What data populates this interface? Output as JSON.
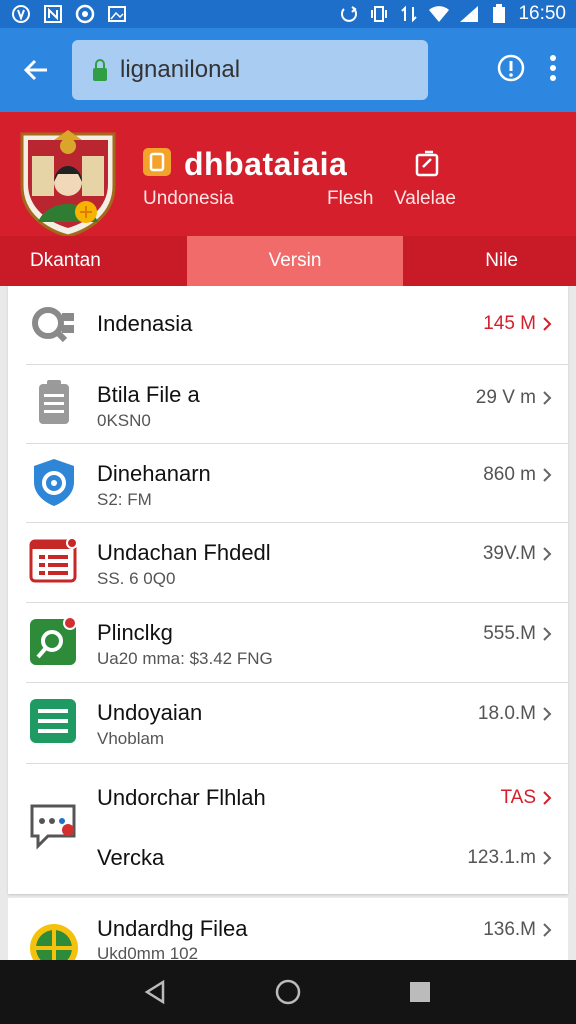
{
  "status_bar": {
    "time": "16:50",
    "icons_left": [
      "vpn-icon",
      "n-app-icon",
      "record-icon",
      "image-icon"
    ],
    "icons_right": [
      "sync-icon",
      "vibrate-icon",
      "data-arrows-icon",
      "wifi-icon",
      "signal-icon",
      "battery-icon"
    ]
  },
  "browser": {
    "url": "lignanilonal",
    "back_icon": "arrow-left-icon",
    "lock_icon": "lock-icon",
    "info_icon": "info-icon",
    "menu_icon": "more-vert-icon"
  },
  "header": {
    "app_title": "dhbataiaia",
    "app_subtitle": "Undonesia",
    "flesh_label": "Flesh",
    "valelae_label": "Valelae",
    "brand_color": "#d51f2c"
  },
  "tabs": [
    {
      "label": "Dkantan",
      "active": false
    },
    {
      "label": "Versin",
      "active": true
    },
    {
      "label": "Nile",
      "active": false
    }
  ],
  "files": [
    {
      "name": "Indenasia",
      "sub": "",
      "size": "145 M",
      "highlight": true,
      "icon": "gear-search-icon"
    },
    {
      "name": "Btila File a",
      "sub": "0KSN0",
      "size": "29 V m",
      "highlight": false,
      "icon": "document-icon"
    },
    {
      "name": "Dinehanarn",
      "sub": "S2: FM",
      "size": "860 m",
      "highlight": false,
      "icon": "shield-icon"
    },
    {
      "name": "Undachan Fhdedl",
      "sub": "SS. 6 0Q0",
      "size": "39V.M",
      "highlight": false,
      "icon": "form-icon"
    },
    {
      "name": "Plinclkg",
      "sub": "Ua20 mma: $3.42 FNG",
      "size": "555.M",
      "highlight": false,
      "icon": "map-pin-icon"
    },
    {
      "name": "Undoyaian",
      "sub": "Vhoblam",
      "size": "18.0.M",
      "highlight": false,
      "icon": "list-card-icon"
    },
    {
      "name": "Undorchar Flhlah",
      "sub": "",
      "size": "TAS",
      "highlight": true,
      "icon": "chat-icon",
      "second_name": "Vercka",
      "second_size": "123.1.m"
    }
  ],
  "partial_file": {
    "name": "Undardhg Filea",
    "sub": "Ukd0mm 102",
    "size": "136.M",
    "icon": "globe-icon"
  },
  "nav": {
    "back_icon": "nav-back-icon",
    "home_icon": "nav-home-icon",
    "recents_icon": "nav-recents-icon"
  }
}
